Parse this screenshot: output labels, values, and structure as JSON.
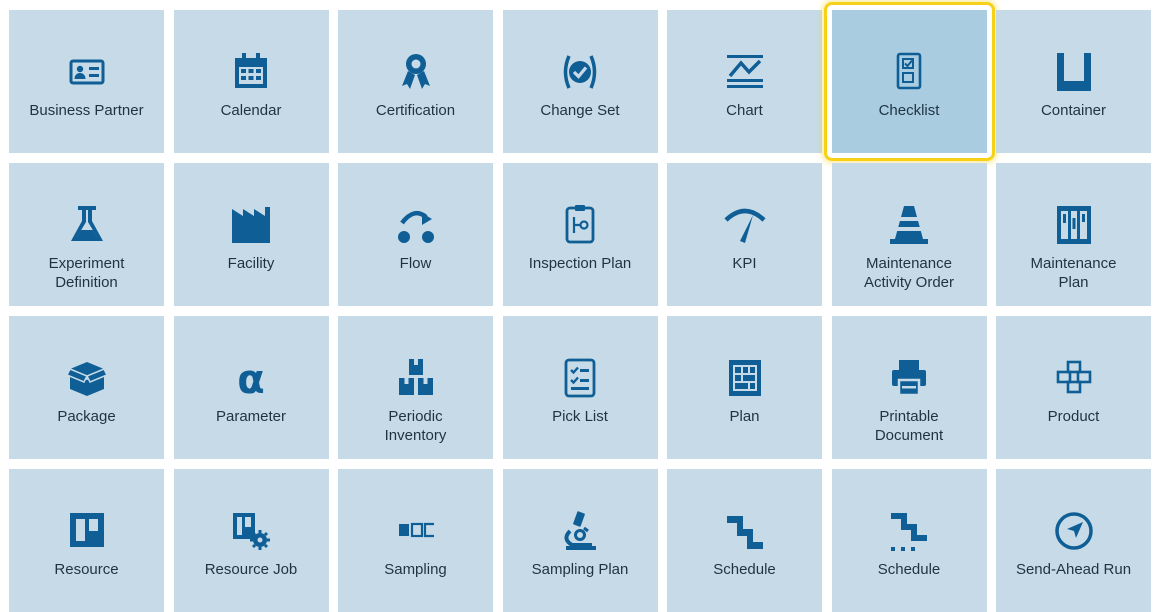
{
  "accent": "#0f5e95",
  "tile_color": "#c6dbe7",
  "selected_border": "#f7d117",
  "selected_tile": "Checklist",
  "tiles": [
    {
      "label": "Business Partner",
      "icon": "business-partner-icon"
    },
    {
      "label": "Calendar",
      "icon": "calendar-icon"
    },
    {
      "label": "Certification",
      "icon": "certification-icon"
    },
    {
      "label": "Change Set",
      "icon": "change-set-icon"
    },
    {
      "label": "Chart",
      "icon": "chart-icon"
    },
    {
      "label": "Checklist",
      "icon": "checklist-icon"
    },
    {
      "label": "Container",
      "icon": "container-icon"
    },
    {
      "label": "Experiment\nDefinition",
      "icon": "experiment-definition-icon"
    },
    {
      "label": "Facility",
      "icon": "facility-icon"
    },
    {
      "label": "Flow",
      "icon": "flow-icon"
    },
    {
      "label": "Inspection Plan",
      "icon": "inspection-plan-icon"
    },
    {
      "label": "KPI",
      "icon": "kpi-icon"
    },
    {
      "label": "Maintenance\nActivity Order",
      "icon": "maintenance-activity-order-icon"
    },
    {
      "label": "Maintenance\nPlan",
      "icon": "maintenance-plan-icon"
    },
    {
      "label": "Package",
      "icon": "package-icon"
    },
    {
      "label": "Parameter",
      "icon": "parameter-icon"
    },
    {
      "label": "Periodic\nInventory",
      "icon": "periodic-inventory-icon"
    },
    {
      "label": "Pick List",
      "icon": "pick-list-icon"
    },
    {
      "label": "Plan",
      "icon": "plan-icon"
    },
    {
      "label": "Printable\nDocument",
      "icon": "printable-document-icon"
    },
    {
      "label": "Product",
      "icon": "product-icon"
    },
    {
      "label": "Resource",
      "icon": "resource-icon"
    },
    {
      "label": "Resource Job",
      "icon": "resource-job-icon"
    },
    {
      "label": "Sampling",
      "icon": "sampling-icon"
    },
    {
      "label": "Sampling Plan",
      "icon": "sampling-plan-icon"
    },
    {
      "label": "Schedule",
      "icon": "schedule-icon"
    },
    {
      "label": "Schedule",
      "icon": "schedule-alt-icon"
    },
    {
      "label": "Send-Ahead Run",
      "icon": "send-ahead-run-icon"
    }
  ]
}
